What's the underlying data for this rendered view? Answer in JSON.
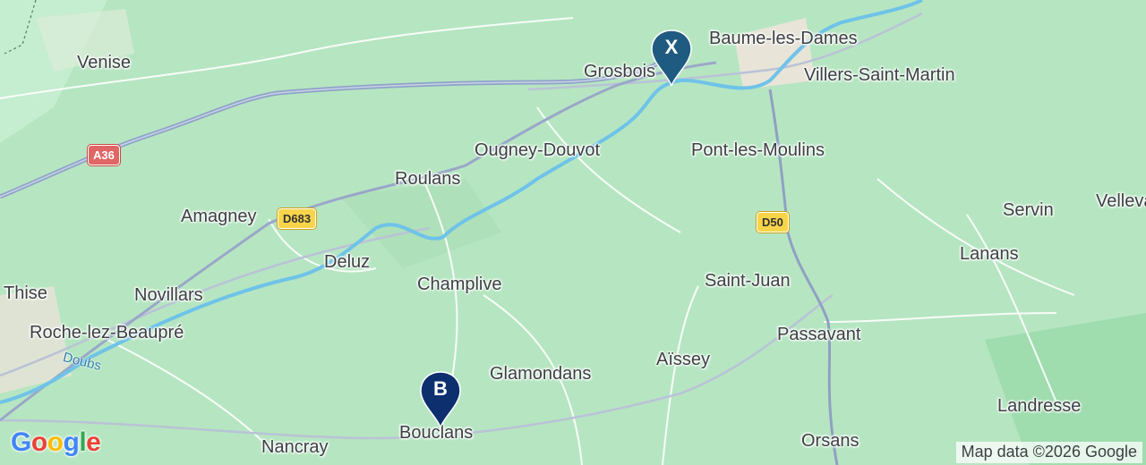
{
  "map": {
    "places": [
      {
        "id": "venise",
        "name": "Venise"
      },
      {
        "id": "grosbois",
        "name": "Grosbois"
      },
      {
        "id": "baume-les-dames",
        "name": "Baume-les-Dames"
      },
      {
        "id": "villers-saint-martin",
        "name": "Villers-Saint-Martin"
      },
      {
        "id": "ougney-douvot",
        "name": "Ougney-Douvot"
      },
      {
        "id": "pont-les-moulins",
        "name": "Pont-les-Moulins"
      },
      {
        "id": "roulans",
        "name": "Roulans"
      },
      {
        "id": "amagney",
        "name": "Amagney"
      },
      {
        "id": "servin",
        "name": "Servin"
      },
      {
        "id": "vellevans",
        "name": "Vellevans"
      },
      {
        "id": "lanans",
        "name": "Lanans"
      },
      {
        "id": "deluz",
        "name": "Deluz"
      },
      {
        "id": "thise",
        "name": "Thise"
      },
      {
        "id": "champlive",
        "name": "Champlive"
      },
      {
        "id": "saint-juan",
        "name": "Saint-Juan"
      },
      {
        "id": "novillars",
        "name": "Novillars"
      },
      {
        "id": "roche-lez-beaupre",
        "name": "Roche-lez-Beaupré"
      },
      {
        "id": "passavant",
        "name": "Passavant"
      },
      {
        "id": "aissey",
        "name": "Aïssey"
      },
      {
        "id": "glamondans",
        "name": "Glamondans"
      },
      {
        "id": "landresse",
        "name": "Landresse"
      },
      {
        "id": "nancray",
        "name": "Nancray"
      },
      {
        "id": "bouclans",
        "name": "Bouclans"
      },
      {
        "id": "orsans",
        "name": "Orsans"
      }
    ],
    "water_labels": [
      {
        "id": "doubs",
        "name": "Doubs"
      }
    ],
    "road_shields": [
      {
        "id": "a36",
        "label": "A36",
        "kind": "motorway"
      },
      {
        "id": "d683",
        "label": "D683",
        "kind": "dept"
      },
      {
        "id": "d50",
        "label": "D50",
        "kind": "dept"
      }
    ],
    "markers": [
      {
        "id": "x",
        "label": "X",
        "color": "#1f5a80"
      },
      {
        "id": "b",
        "label": "B",
        "color": "#0d2f6e"
      }
    ],
    "colors": {
      "land": "#b9e8c4",
      "water": "#6fc3e8",
      "motorway": "#8fa3c8",
      "urban": "#e9e3d6"
    },
    "logo": {
      "text": "Google"
    },
    "attribution": "Map data ©2026 Google"
  }
}
